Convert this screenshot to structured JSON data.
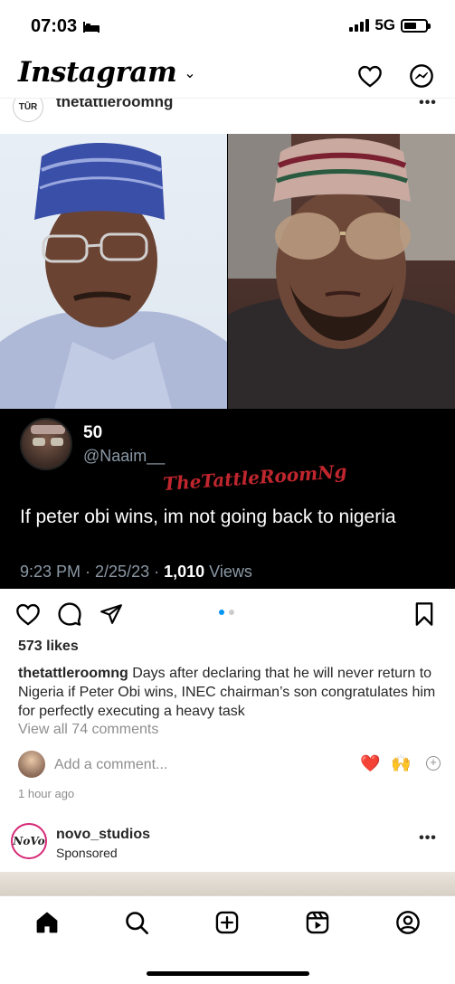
{
  "status_bar": {
    "time": "07:03",
    "network": "5G",
    "battery_percent": 60
  },
  "header": {
    "app_name": "Instagram"
  },
  "post": {
    "username": "thetattleroomng",
    "avatar_text": "TŪR",
    "embedded_tweet": {
      "display_name": "50",
      "handle": "@Naaim__",
      "watermark": "TheTattleRoomNg",
      "text": "If peter obi wins, im not going back to nigeria",
      "time_date": "9:23 PM · 2/25/23 · ",
      "views_count": "1,010",
      "views_label": " Views"
    },
    "carousel": {
      "count": 2,
      "active_index": 0
    },
    "likes": "573 likes",
    "caption_username": "thetattleroomng",
    "caption_text": " Days after declaring that he will never return to Nigeria if Peter Obi wins, INEC chairman’s son congratulates him for perfectly executing a heavy task",
    "view_comments": "View all 74 comments",
    "add_comment_placeholder": "Add a comment...",
    "quick_emojis": [
      "❤️",
      "🙌"
    ],
    "time_ago": "1 hour ago"
  },
  "next_post": {
    "username": "novo_studios",
    "sponsored_label": "Sponsored",
    "avatar_text": "NoVo"
  },
  "colors": {
    "accent": "#0095f6",
    "watermark_red": "#c0262d",
    "tweet_muted": "#8b98a5"
  },
  "nav": {
    "items": [
      "home-icon",
      "search-icon",
      "create-icon",
      "reels-icon",
      "profile-icon"
    ]
  }
}
